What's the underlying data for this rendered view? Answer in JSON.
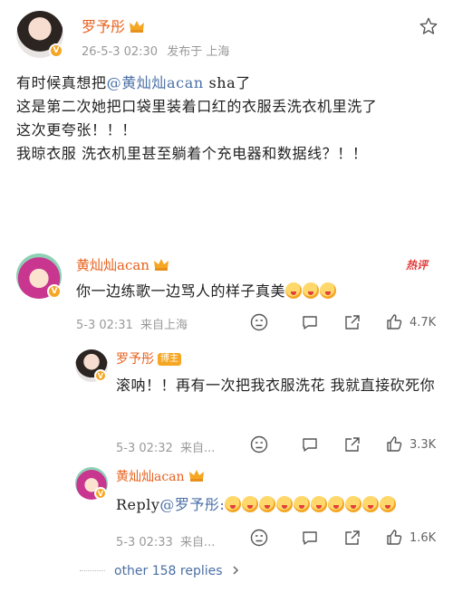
{
  "post": {
    "author": "罗予彤",
    "time": "26-5-3 02:30",
    "location": "发布于 上海",
    "lines": [
      {
        "pre": "有时候真想把",
        "mention": "@黄灿灿acan",
        "post": " sha了"
      },
      {
        "pre": "这是第二次她把口袋里装着口红的衣服丢洗衣机里洗了"
      },
      {
        "pre": "这次更夸张！！！"
      },
      {
        "pre": "我晾衣服 洗衣机里甚至躺着个充电器和数据线？！！"
      }
    ]
  },
  "comments": [
    {
      "author": "黄灿灿acan",
      "hot_label": "热评",
      "text": "你一边练歌一边骂人的样子真美",
      "emoji_count": 3,
      "time": "5-3 02:31",
      "location": "来自上海",
      "likes": "4.7K"
    }
  ],
  "replies": [
    {
      "author": "罗予彤",
      "badge": "博主",
      "text": "滚呐！！再有一次把我衣服洗花 我就直接砍死你",
      "time": "5-3 02:32",
      "location": "来自...",
      "likes": "3.3K"
    },
    {
      "author": "黄灿灿acan",
      "text_prefix": "Reply",
      "mention": "@罗予彤:",
      "emoji_count": 10,
      "time": "5-3 02:33",
      "location": "来自...",
      "likes": "1.6K"
    }
  ],
  "more_replies": "other 158 replies",
  "icons": {
    "star": "star-icon",
    "verified": "verified-badge-icon",
    "crown": "crown-icon",
    "dislike": "dislike-icon",
    "comment": "comment-icon",
    "share": "share-icon",
    "like": "like-icon",
    "chevron": "chevron-right-icon"
  }
}
